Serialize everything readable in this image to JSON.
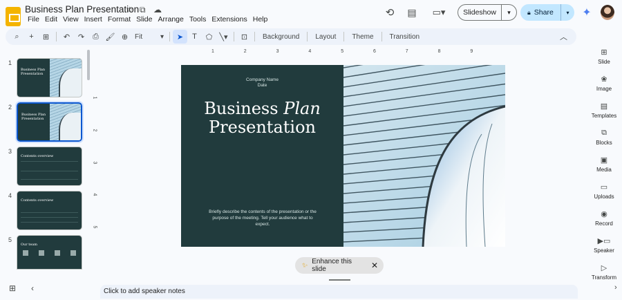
{
  "header": {
    "title": "Business Plan Presentation",
    "menu": [
      "File",
      "Edit",
      "View",
      "Insert",
      "Format",
      "Slide",
      "Arrange",
      "Tools",
      "Extensions",
      "Help"
    ],
    "slideshow_label": "Slideshow",
    "share_label": "Share"
  },
  "toolbar": {
    "zoom": "Fit",
    "background_label": "Background",
    "layout_label": "Layout",
    "theme_label": "Theme",
    "transition_label": "Transition"
  },
  "filmstrip": {
    "numbers": [
      "1",
      "2",
      "3",
      "4",
      "5"
    ],
    "thumb_title_line1": "Business Plan",
    "thumb_title_line2": "Presentation",
    "thumb3_title": "Contents overview",
    "thumb4_title": "Contents overview",
    "thumb5_title": "Our team"
  },
  "rulers": {
    "top": [
      "1",
      "2",
      "3",
      "4",
      "5",
      "6",
      "7",
      "8",
      "9"
    ],
    "left": [
      "1",
      "2",
      "3",
      "4",
      "5"
    ]
  },
  "slide": {
    "company": "Company Name",
    "date": "Date",
    "title_part1": "Business ",
    "title_part2": "Plan",
    "title_line2": "Presentation",
    "description": "Briefly describe the contents of the presentation or the purpose of the meeting. Tell your audience what to expect."
  },
  "enhance_label": "Enhance this slide",
  "notes_placeholder": "Click to add speaker notes",
  "side_panel": [
    "Slide",
    "Image",
    "Templates",
    "Blocks",
    "Media",
    "Uploads",
    "Record",
    "Speaker",
    "Transform"
  ],
  "colors": {
    "slide_bg": "#213b3d",
    "accent": "#0b57d0",
    "share_bg": "#c2e7ff"
  }
}
